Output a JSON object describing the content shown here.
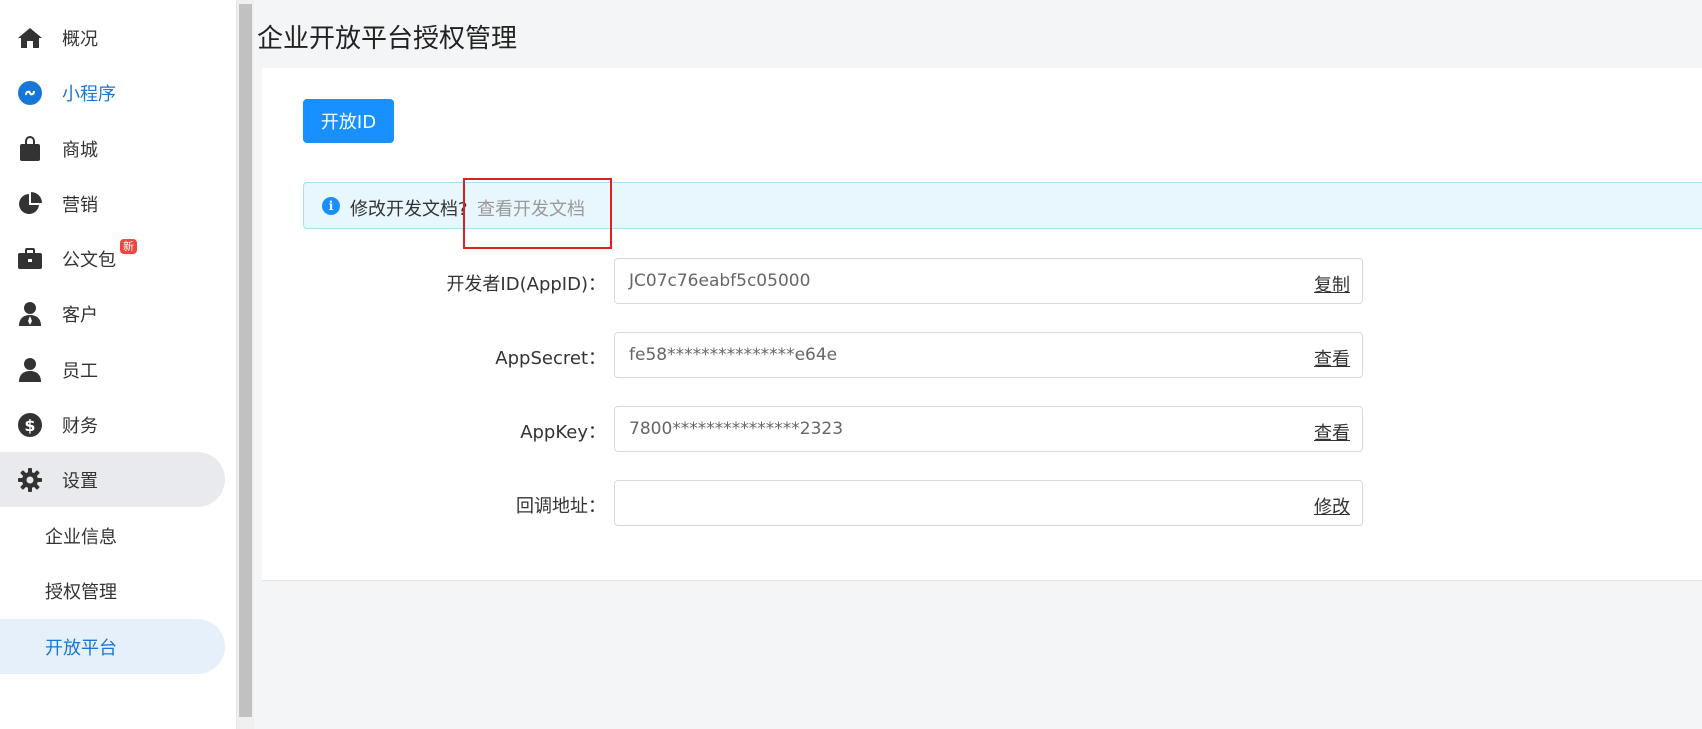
{
  "sidebar": {
    "items": [
      {
        "label": "概况",
        "icon": "home-icon"
      },
      {
        "label": "小程序",
        "icon": "mini-program-icon"
      },
      {
        "label": "商城",
        "icon": "shopping-bag-icon"
      },
      {
        "label": "营销",
        "icon": "pie-chart-icon"
      },
      {
        "label": "公文包",
        "icon": "briefcase-icon",
        "badge": "新"
      },
      {
        "label": "客户",
        "icon": "customer-icon"
      },
      {
        "label": "员工",
        "icon": "user-icon"
      },
      {
        "label": "财务",
        "icon": "dollar-icon"
      },
      {
        "label": "设置",
        "icon": "gear-icon"
      }
    ],
    "sub_items": [
      {
        "label": "企业信息"
      },
      {
        "label": "授权管理"
      },
      {
        "label": "开放平台"
      }
    ]
  },
  "page": {
    "title": "企业开放平台授权管理",
    "open_id_button": "开放ID",
    "alert": {
      "message": "修改开发文档?",
      "link": "查看开发文档"
    },
    "form": [
      {
        "label": "开发者ID(AppID)：",
        "value": "JC07c76eabf5c05000",
        "action": "复制"
      },
      {
        "label": "AppSecret：",
        "value": "fe58***************e64e",
        "action": "查看"
      },
      {
        "label": "AppKey：",
        "value": "7800***************2323",
        "action": "查看"
      },
      {
        "label": "回调地址：",
        "value": "",
        "action": "修改"
      }
    ]
  },
  "colors": {
    "accent": "#1890ff",
    "active_text": "#1677d8",
    "highlight": "#e02020",
    "badge": "#f2453d"
  }
}
